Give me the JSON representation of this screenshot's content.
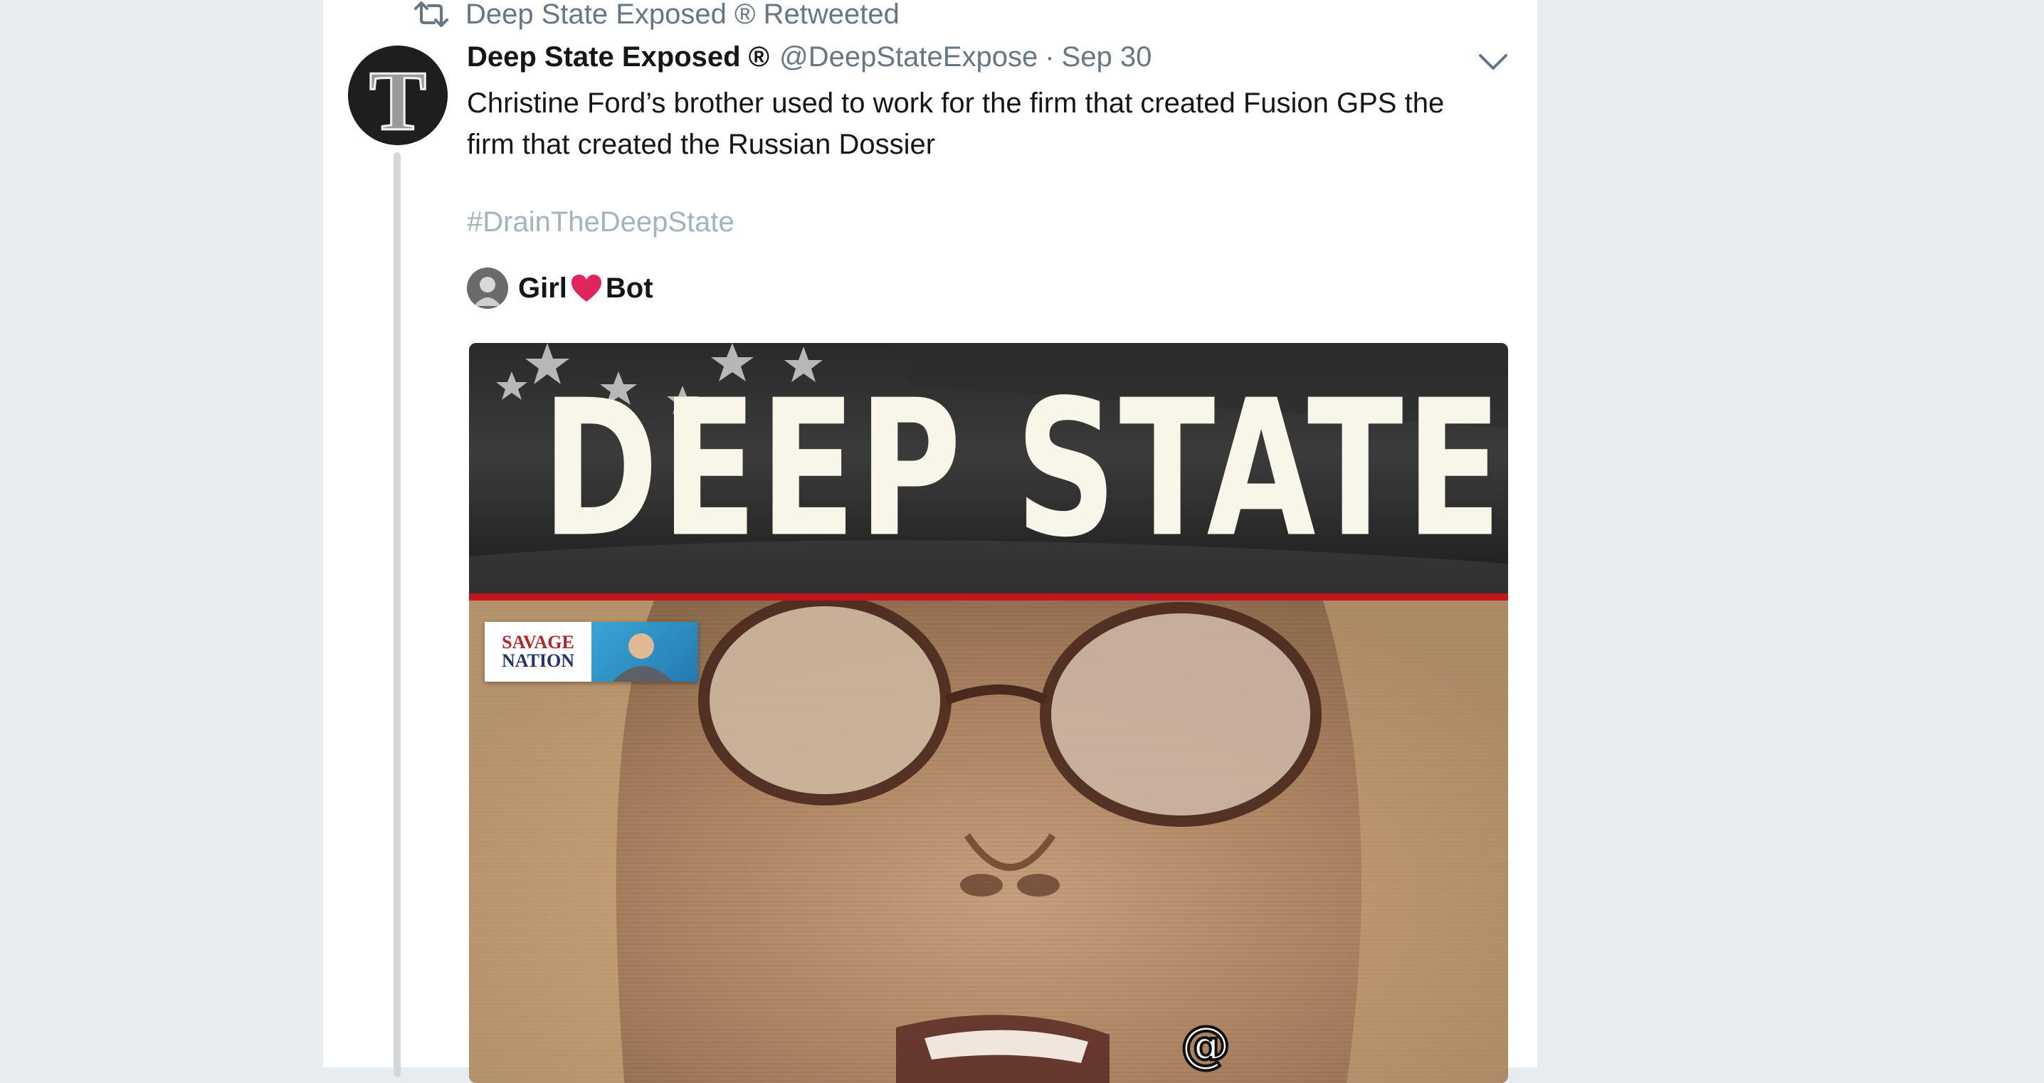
{
  "retweet_context": {
    "label": "Deep State Exposed ® Retweeted",
    "icon": "retweet-icon"
  },
  "tweet": {
    "fullname": "Deep State Exposed ®",
    "handle": "@DeepStateExpose",
    "separator": "·",
    "timestamp": "Sep 30",
    "avatar_letter": "T",
    "text": "Christine Ford’s brother used to work for the firm that created Fusion GPS the firm that created the Russian Dossier",
    "hashtag": "#DrainTheDeepState",
    "caret_icon": "chevron-down-icon"
  },
  "quoted_author": {
    "name_left": "Girl",
    "name_right": "Bot",
    "icon": "heart-icon"
  },
  "media": {
    "headline": "DEEP STATE",
    "logo_line1": "SAVAGE",
    "logo_line2": "NATION",
    "watermark": "@"
  },
  "colors": {
    "background": "#e6ecf0",
    "card": "#ffffff",
    "primary_text": "#14171a",
    "secondary_text": "#657786",
    "hashtag": "#a3b3c0",
    "heart": "#e0245e",
    "media_red_bar": "#c3161c"
  }
}
